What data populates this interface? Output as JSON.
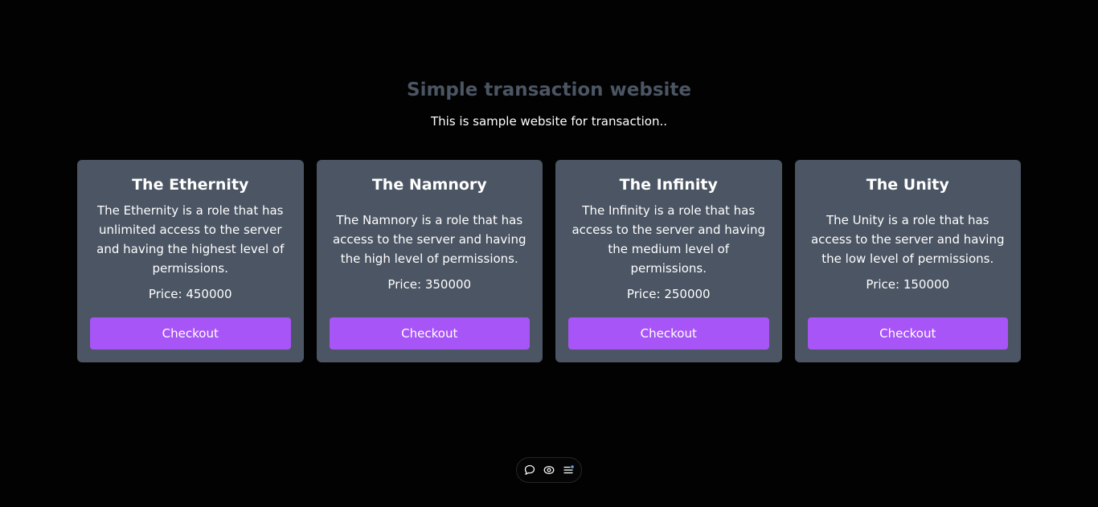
{
  "header": {
    "title": "Simple transaction website",
    "subtitle": "This is sample website for transaction.."
  },
  "cards": [
    {
      "title": "The Ethernity",
      "description": "The Ethernity is a role that has unlimited access to the server and having the highest level of permissions.",
      "price": "Price: 450000",
      "button": "Checkout"
    },
    {
      "title": "The Namnory",
      "description": "The Namnory is a role that has access to the server and having the high level of permissions.",
      "price": "Price: 350000",
      "button": "Checkout"
    },
    {
      "title": "The Infinity",
      "description": "The Infinity is a role that has access to the server and having the medium level of permissions.",
      "price": "Price: 250000",
      "button": "Checkout"
    },
    {
      "title": "The Unity",
      "description": "The Unity is a role that has access to the server and having the low level of permissions.",
      "price": "Price: 150000",
      "button": "Checkout"
    }
  ],
  "toolbar": {
    "icons": [
      "comment-icon",
      "eye-icon",
      "menu-icon"
    ]
  },
  "colors": {
    "background": "#020202",
    "card": "#4b5563",
    "title": "#4b5563",
    "accent": "#a855f7",
    "indicator": "#60a5fa"
  }
}
